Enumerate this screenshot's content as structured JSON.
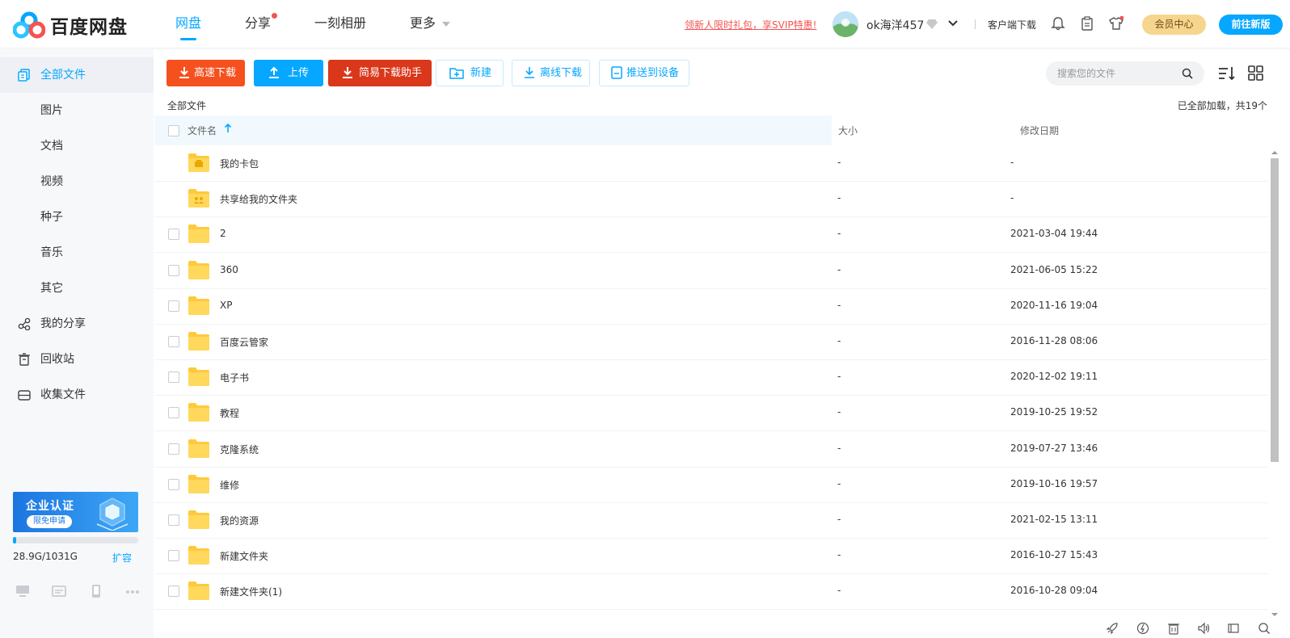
{
  "header": {
    "logo_text": "百度网盘",
    "nav": [
      {
        "label": "网盘",
        "active": true
      },
      {
        "label": "分享",
        "dot": true
      },
      {
        "label": "一刻相册"
      },
      {
        "label": "更多",
        "caret": true
      }
    ],
    "promo_text": "领新人限时礼包，享SVIP特惠!",
    "username": "ok海洋457",
    "client_download": "客户端下载",
    "member_center": "会员中心",
    "new_version": "前往新版",
    "colors": {
      "accent": "#06a7ff",
      "promo": "#f5534f",
      "member_bg": "#f6d58e"
    }
  },
  "sidebar": {
    "items": [
      {
        "label": "全部文件",
        "icon": "all-files-icon",
        "active": true
      },
      {
        "label": "图片"
      },
      {
        "label": "文档"
      },
      {
        "label": "视频"
      },
      {
        "label": "种子"
      },
      {
        "label": "音乐"
      },
      {
        "label": "其它"
      },
      {
        "label": "我的分享",
        "icon": "share-icon"
      },
      {
        "label": "回收站",
        "icon": "trash-icon"
      },
      {
        "label": "收集文件",
        "icon": "collect-icon"
      }
    ],
    "ad": {
      "title": "企业认证",
      "button": "限免申请"
    },
    "quota": {
      "used": "28.9G",
      "total": "1031G",
      "text": "28.9G/1031G",
      "fraction": 0.028,
      "expand": "扩容"
    },
    "bottom_icons": [
      "pc-icon",
      "mail-icon",
      "phone-icon",
      "more-icon"
    ]
  },
  "toolbar": {
    "fast_download": "高速下载",
    "upload": "上传",
    "simple_download_helper": "简易下载助手",
    "new": "新建",
    "offline_download": "离线下载",
    "push_to_device": "推送到设备",
    "search_placeholder": "搜索您的文件"
  },
  "breadcrumb": "全部文件",
  "loaded_info": "已全部加载，共19个",
  "table": {
    "headers": {
      "name": "文件名",
      "size": "大小",
      "date": "修改日期"
    },
    "rows": [
      {
        "name": "我的卡包",
        "size": "-",
        "date": "-",
        "special": "wallet",
        "checkbox": false
      },
      {
        "name": "共享给我的文件夹",
        "size": "-",
        "date": "-",
        "special": "shared",
        "checkbox": false
      },
      {
        "name": "2",
        "size": "-",
        "date": "2021-03-04 19:44",
        "checkbox": true
      },
      {
        "name": "360",
        "size": "-",
        "date": "2021-06-05 15:22",
        "checkbox": true
      },
      {
        "name": "XP",
        "size": "-",
        "date": "2020-11-16 19:04",
        "checkbox": true
      },
      {
        "name": "百度云管家",
        "size": "-",
        "date": "2016-11-28 08:06",
        "checkbox": true
      },
      {
        "name": "电子书",
        "size": "-",
        "date": "2020-12-02 19:11",
        "checkbox": true
      },
      {
        "name": "教程",
        "size": "-",
        "date": "2019-10-25 19:52",
        "checkbox": true
      },
      {
        "name": "克隆系统",
        "size": "-",
        "date": "2019-07-27 13:46",
        "checkbox": true
      },
      {
        "name": "维修",
        "size": "-",
        "date": "2019-10-16 19:57",
        "checkbox": true
      },
      {
        "name": "我的资源",
        "size": "-",
        "date": "2021-02-15 13:11",
        "checkbox": true
      },
      {
        "name": "新建文件夹",
        "size": "-",
        "date": "2016-10-27 15:43",
        "checkbox": true
      },
      {
        "name": "新建文件夹(1)",
        "size": "-",
        "date": "2016-10-28 09:04",
        "checkbox": true
      }
    ]
  },
  "statusbar_icons": [
    "rocket-icon",
    "speed-icon",
    "clear-icon",
    "sound-icon",
    "window-icon",
    "search-icon"
  ]
}
